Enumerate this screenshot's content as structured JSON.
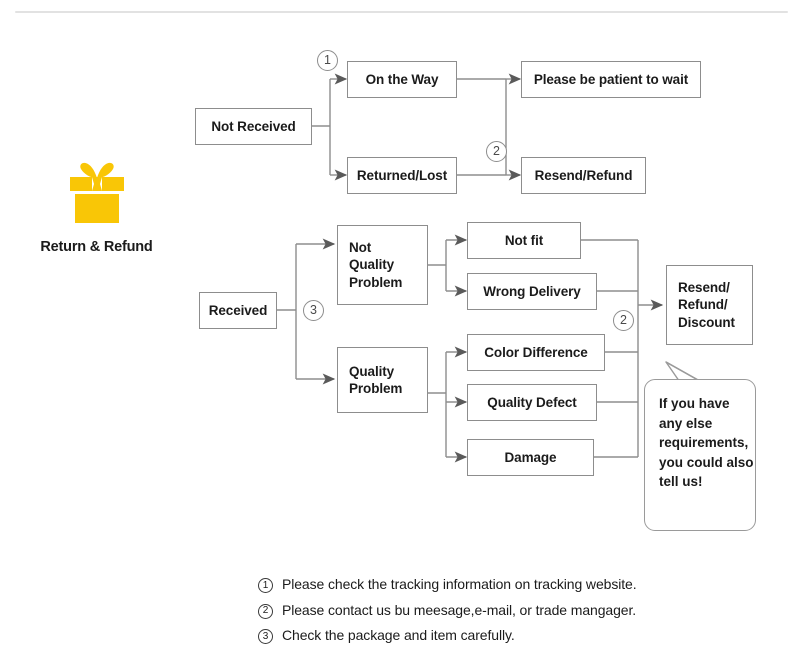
{
  "brand": {
    "label": "Return & Refund",
    "icon": "gift-box-icon",
    "icon_color": "#F9C606"
  },
  "theme": {
    "box_border": "#8d8d8d",
    "wire": "#8d8d8d",
    "arrow": "#5a5a5a",
    "text": "#1b1b1b",
    "rule": "#e2e2e2"
  },
  "flow": {
    "not_received": "Not Received",
    "on_the_way": "On the Way",
    "returned_lost": "Returned/Lost",
    "please_wait": "Please be patient to wait",
    "resend_refund": "Resend/Refund",
    "received": "Received",
    "not_quality_problem": "Not\nQuality\nProblem",
    "quality_problem": "Quality\nProblem",
    "not_fit": "Not fit",
    "wrong_delivery": "Wrong Delivery",
    "color_difference": "Color Difference",
    "quality_defect": "Quality Defect",
    "damage": "Damage",
    "resend_refund_discount": "Resend/\nRefund/\nDiscount"
  },
  "markers": {
    "m1": "1",
    "m2_top": "2",
    "m3": "3",
    "m2_right": "2"
  },
  "bubble": {
    "text": "If you have any else requirements, you could also tell us!"
  },
  "legend": [
    {
      "num": "1",
      "text": "Please check the tracking information on tracking website."
    },
    {
      "num": "2",
      "text": "Please contact us bu meesage,e-mail, or trade mangager."
    },
    {
      "num": "3",
      "text": "Check the package and item carefully."
    }
  ]
}
